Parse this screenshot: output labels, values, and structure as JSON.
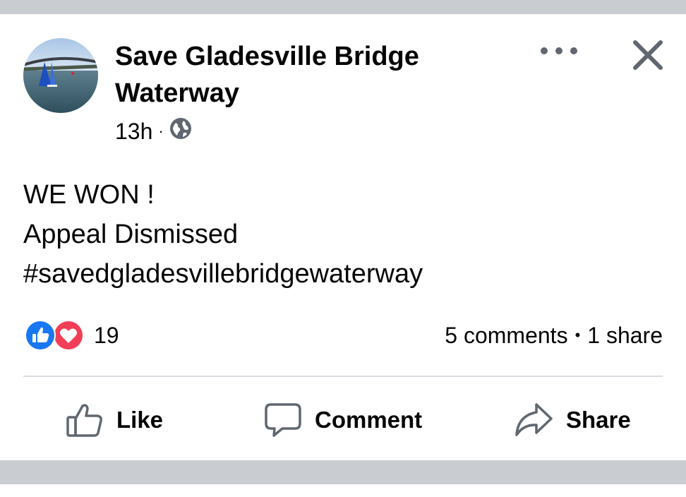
{
  "post": {
    "author": "Save Gladesville Bridge Waterway",
    "time": "13h",
    "privacy_icon": "globe-icon",
    "body_lines": [
      "WE WON !",
      "Appeal Dismissed",
      "#savedgladesvillebridgewaterway"
    ],
    "reaction_count": "19",
    "reactions": [
      "like-icon",
      "love-icon"
    ],
    "comments": "5 comments",
    "shares": "1 share"
  },
  "actions": {
    "like": "Like",
    "comment": "Comment",
    "share": "Share"
  },
  "colors": {
    "like_blue": "#1877f2",
    "love_red": "#f33e58",
    "icon_gray": "#606770",
    "band_gray": "#c9ccd1"
  }
}
